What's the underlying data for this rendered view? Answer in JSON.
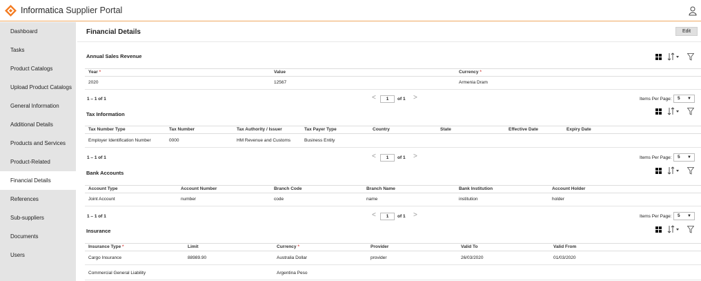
{
  "app": {
    "brand": "Informatica",
    "title": "Supplier Portal"
  },
  "sidebar": {
    "items": [
      {
        "label": "Dashboard"
      },
      {
        "label": "Tasks"
      },
      {
        "label": "Product Catalogs"
      },
      {
        "label": "Upload Product Catalogs"
      },
      {
        "label": "General Information"
      },
      {
        "label": "Additional Details"
      },
      {
        "label": "Products and Services"
      },
      {
        "label": "Product-Related Questions"
      },
      {
        "label": "Financial Details"
      },
      {
        "label": "References"
      },
      {
        "label": "Sub-suppliers"
      },
      {
        "label": "Documents"
      },
      {
        "label": "Users"
      }
    ],
    "active": "Financial Details"
  },
  "page": {
    "title": "Financial Details",
    "edit_label": "Edit"
  },
  "pager": {
    "summary": "1 – 1 of 1",
    "page": "1",
    "of": "of 1",
    "items_per_page_label": "Items Per Page:",
    "items_per_page": "5"
  },
  "sections": {
    "annual": {
      "title": "Annual Sales Revenue",
      "headers": {
        "year": "Year",
        "value": "Value",
        "currency": "Currency"
      },
      "rows": [
        {
          "year": "2020",
          "value": "12567",
          "currency": "Armenia Dram"
        }
      ]
    },
    "tax": {
      "title": "Tax Information",
      "headers": {
        "type": "Tax Number Type",
        "number": "Tax Number",
        "authority": "Tax Authority / Issuer",
        "payer": "Tax Payer Type",
        "country": "Country",
        "state": "State",
        "effective": "Effective Date",
        "expiry": "Expiry Date"
      },
      "rows": [
        {
          "type": "Employer Identification Number",
          "number": "0000",
          "authority": "HM Revenue and Customs",
          "payer": "Business Entity"
        }
      ]
    },
    "bank": {
      "title": "Bank Accounts",
      "headers": {
        "type": "Account Type",
        "number": "Account Number",
        "branch_code": "Branch Code",
        "branch_name": "Branch Name",
        "institution": "Bank Institution",
        "holder": "Account Holder"
      },
      "rows": [
        {
          "type": "Joint Account",
          "number": "number",
          "branch_code": "code",
          "branch_name": "name",
          "institution": "institution",
          "holder": "holder"
        }
      ]
    },
    "insurance": {
      "title": "Insurance",
      "headers": {
        "type": "Insurance Type",
        "limit": "Limit",
        "currency": "Currency",
        "provider": "Provider",
        "valid_to": "Valid To",
        "valid_from": "Valid From"
      },
      "rows": [
        {
          "type": "Cargo Insurance",
          "limit": "88989.90",
          "currency": "Australia Dollar",
          "provider": "provider",
          "valid_to": "26/03/2020",
          "valid_from": "01/03/2020"
        },
        {
          "type": "Commercial General Liability",
          "currency": "Argentina Peso"
        }
      ]
    }
  },
  "required_marker": "*",
  "colors": {
    "accent": "#f0a860",
    "sidebar_bg": "#e4e4e4",
    "required": "#d9534f"
  }
}
